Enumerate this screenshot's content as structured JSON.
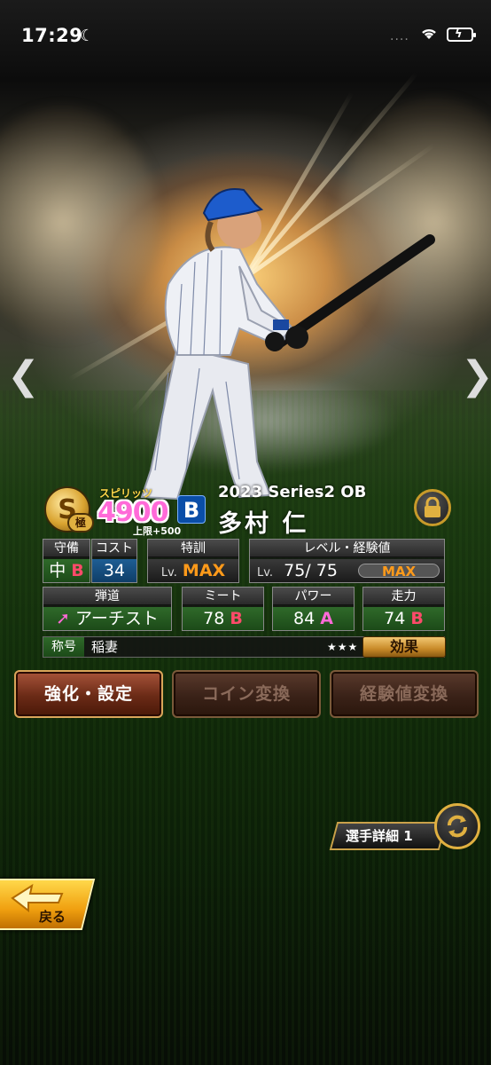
{
  "status_bar": {
    "time": "17:29"
  },
  "player": {
    "rarity": "S",
    "rank_badge": "極",
    "spirits_label": "スピリッツ",
    "spirits_value": "4900",
    "spirits_limit": "上限+500",
    "team_logo": "B",
    "series": "2023 Series2 OB",
    "name": "多村 仁"
  },
  "stats": {
    "defense": {
      "label": "守備",
      "position": "中",
      "grade": "B"
    },
    "cost": {
      "label": "コスト",
      "value": "34"
    },
    "training": {
      "label": "特訓",
      "lv": "Lv.",
      "value": "MAX"
    },
    "level": {
      "label": "レベル・経験値",
      "lv": "Lv.",
      "value": "75/ 75",
      "exp": "MAX"
    },
    "trajectory": {
      "label": "弾道",
      "value": "アーチスト"
    },
    "meet": {
      "label": "ミート",
      "value": "78",
      "grade": "B"
    },
    "power": {
      "label": "パワー",
      "value": "84",
      "grade": "A"
    },
    "speed": {
      "label": "走力",
      "value": "74",
      "grade": "B"
    }
  },
  "title": {
    "label": "称号",
    "value": "稲妻",
    "stars": "★★★",
    "effect_button": "効果"
  },
  "actions": {
    "enhance": "強化・設定",
    "coin": "コイン変換",
    "exp": "経験値変換"
  },
  "detail": {
    "label": "選手詳細 1"
  },
  "back": {
    "label": "戻る"
  },
  "colors": {
    "grade_b": "#ff4a6a",
    "grade_a": "#ff6ad8",
    "max": "#ff9a1a",
    "gold": "#e0b040"
  }
}
